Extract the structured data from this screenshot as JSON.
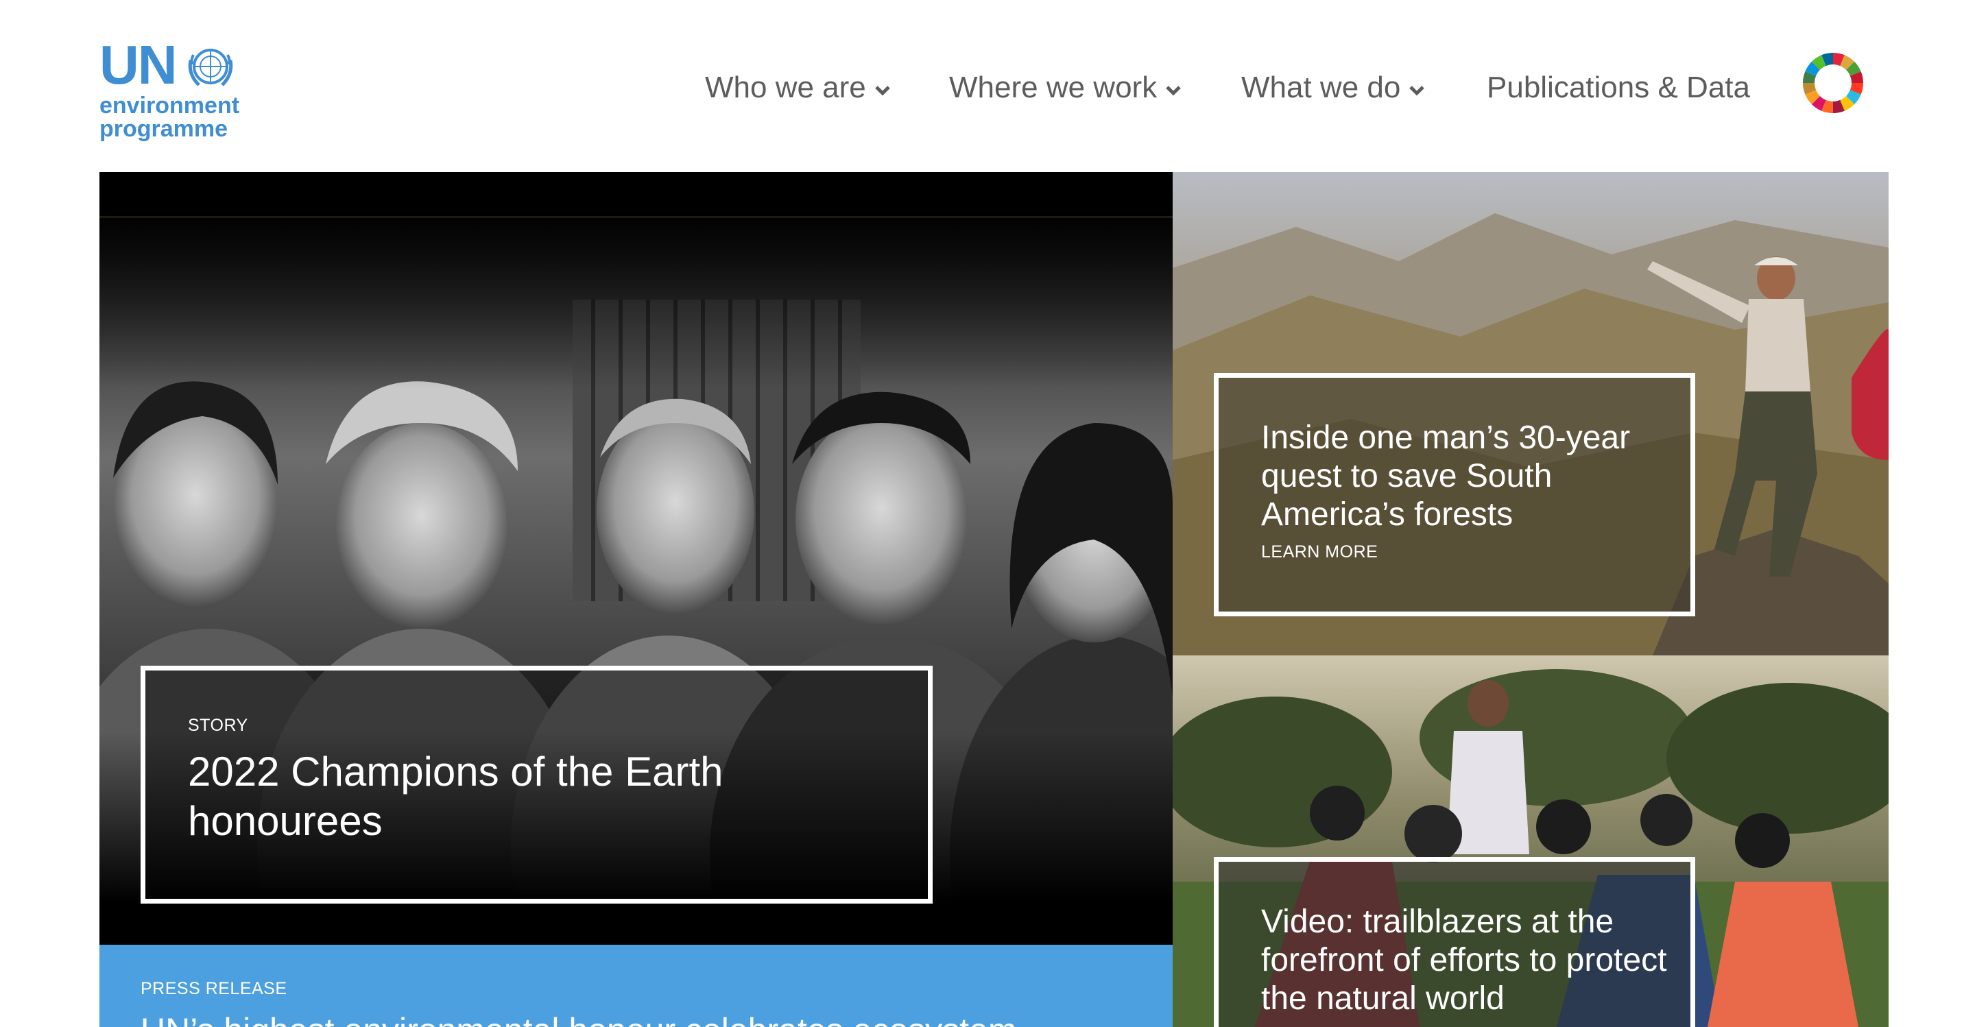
{
  "logo": {
    "un": "UN",
    "line1": "environment",
    "line2": "programme",
    "emblem_icon": "un-emblem-icon"
  },
  "nav": {
    "items": [
      {
        "label": "Who we are",
        "has_dropdown": true
      },
      {
        "label": "Where we work",
        "has_dropdown": true
      },
      {
        "label": "What we do",
        "has_dropdown": true
      },
      {
        "label": "Publications & Data",
        "has_dropdown": false
      }
    ],
    "sdg_icon": "sdg-wheel-icon"
  },
  "hero": {
    "kicker": "STORY",
    "title": "2022 Champions of the Earth honourees"
  },
  "press": {
    "kicker": "PRESS RELEASE",
    "title": "UN’s highest environmental honour celebrates ecosystem"
  },
  "side1": {
    "title": "Inside one man’s 30-year quest to save South America’s forests",
    "more": "LEARN MORE"
  },
  "side2": {
    "title": "Video: trailblazers at the forefront of efforts to protect the natural world"
  },
  "colors": {
    "brand_blue": "#3f8dd2",
    "press_blue": "#4da0e0",
    "nav_text": "#5c5c5c"
  }
}
